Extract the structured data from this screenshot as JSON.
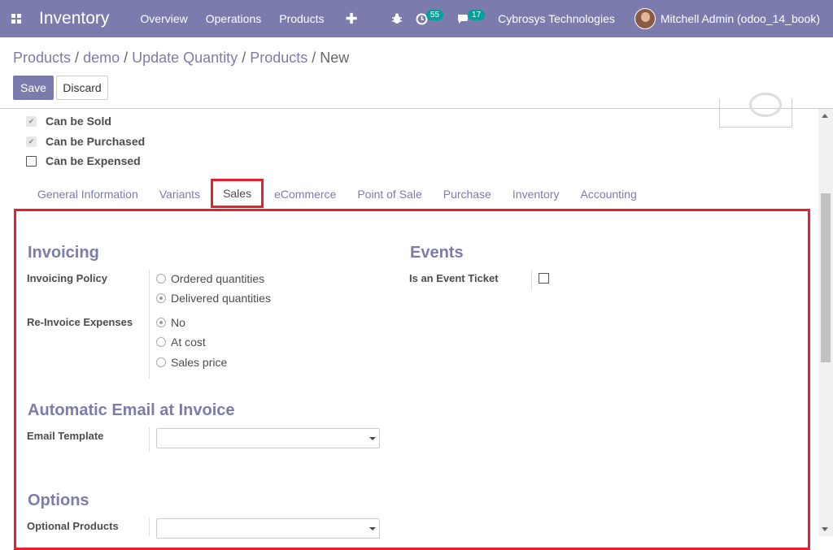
{
  "navbar": {
    "brand": "Inventory",
    "menu": [
      "Overview",
      "Operations",
      "Products"
    ],
    "plus": "✚",
    "activities_count": "55",
    "messages_count": "17",
    "company": "Cybrosys Technologies",
    "user": "Mitchell Admin (odoo_14_book)"
  },
  "breadcrumb": {
    "items": [
      "Products",
      "demo",
      "Update Quantity",
      "Products"
    ],
    "current": "New"
  },
  "buttons": {
    "save": "Save",
    "discard": "Discard"
  },
  "options": [
    {
      "label": "Can be Sold",
      "checked": true
    },
    {
      "label": "Can be Purchased",
      "checked": true
    },
    {
      "label": "Can be Expensed",
      "checked": false
    }
  ],
  "tabs": [
    "General Information",
    "Variants",
    "Sales",
    "eCommerce",
    "Point of Sale",
    "Purchase",
    "Inventory",
    "Accounting"
  ],
  "active_tab": "Sales",
  "invoicing": {
    "title": "Invoicing",
    "policy_label": "Invoicing Policy",
    "policy_options": [
      "Ordered quantities",
      "Delivered quantities"
    ],
    "policy_selected": "Delivered quantities",
    "reinvoice_label": "Re-Invoice Expenses",
    "reinvoice_options": [
      "No",
      "At cost",
      "Sales price"
    ],
    "reinvoice_selected": "No"
  },
  "events": {
    "title": "Events",
    "ticket_label": "Is an Event Ticket",
    "ticket_checked": false
  },
  "email": {
    "title": "Automatic Email at Invoice",
    "template_label": "Email Template",
    "template_value": ""
  },
  "options_section": {
    "title": "Options",
    "optional_products_label": "Optional Products",
    "optional_products_value": ""
  },
  "colors": {
    "primary": "#7c7bad",
    "highlight": "#e4212c"
  }
}
